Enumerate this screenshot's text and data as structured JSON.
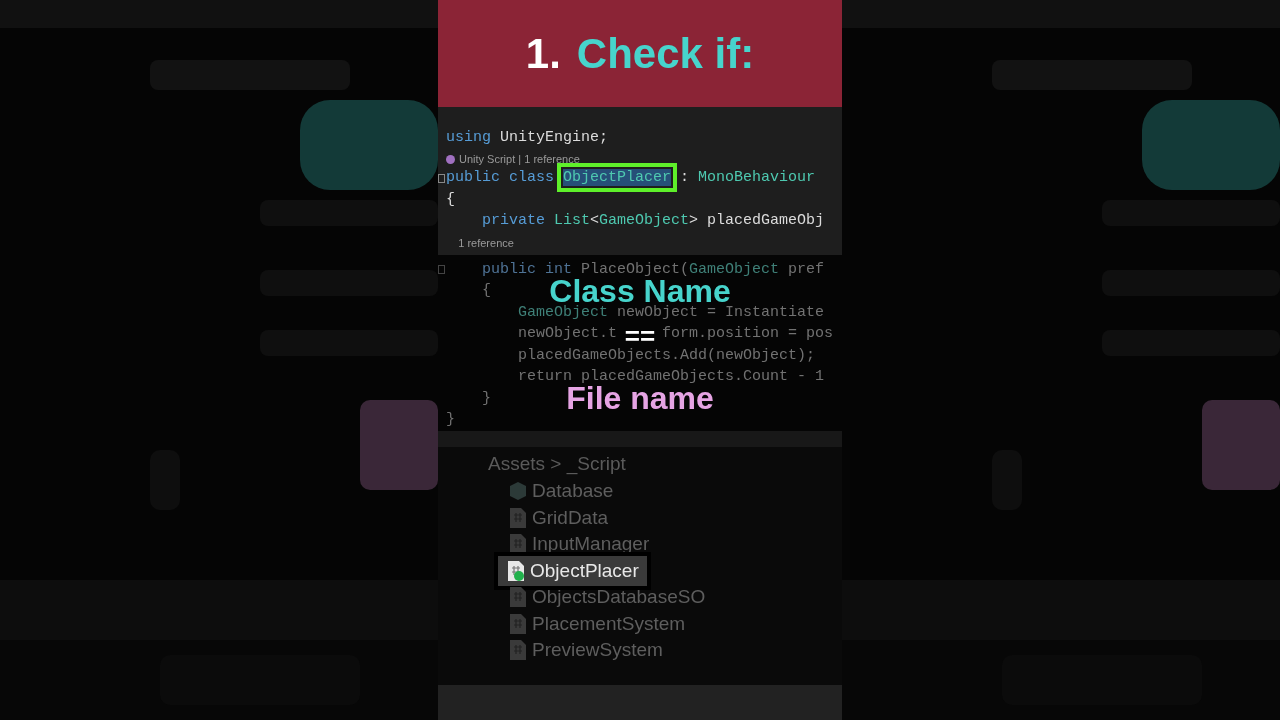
{
  "banner": {
    "number": "1.",
    "title": "Check if:"
  },
  "code_editor": {
    "lines": [
      {
        "kind": "code",
        "dimmed": false,
        "tokens": [
          {
            "text": "using",
            "kind": "keyword"
          },
          {
            "text": " UnityEngine;",
            "kind": "plain"
          }
        ]
      },
      {
        "kind": "hint",
        "dimmed": false,
        "text": "Unity Script | 1 reference",
        "icon": true
      },
      {
        "kind": "code",
        "dimmed": false,
        "fold": true,
        "tokens": [
          {
            "text": "public class ",
            "kind": "keyword"
          },
          {
            "text": "ObjectPlacer",
            "kind": "selected"
          },
          {
            "text": " : ",
            "kind": "plain"
          },
          {
            "text": "MonoBehaviour",
            "kind": "type"
          }
        ]
      },
      {
        "kind": "code",
        "dimmed": false,
        "tokens": [
          {
            "text": "{",
            "kind": "plain"
          }
        ]
      },
      {
        "kind": "code",
        "dimmed": false,
        "tokens": [
          {
            "text": "    private ",
            "kind": "keyword"
          },
          {
            "text": "List",
            "kind": "type"
          },
          {
            "text": "<",
            "kind": "plain"
          },
          {
            "text": "GameObject",
            "kind": "type"
          },
          {
            "text": "> placedGameObj",
            "kind": "plain"
          }
        ]
      },
      {
        "kind": "hint",
        "dimmed": false,
        "text": "    1 reference",
        "icon": false
      },
      {
        "kind": "code",
        "dimmed": true,
        "fold": true,
        "tokens": [
          {
            "text": "    public int ",
            "kind": "keyword"
          },
          {
            "text": "PlaceObject(",
            "kind": "plain"
          },
          {
            "text": "GameObject",
            "kind": "type"
          },
          {
            "text": " pref",
            "kind": "plain"
          }
        ]
      },
      {
        "kind": "code",
        "dimmed": true,
        "tokens": [
          {
            "text": "    {",
            "kind": "plain"
          }
        ]
      },
      {
        "kind": "code",
        "dimmed": true,
        "tokens": [
          {
            "text": "        GameObject",
            "kind": "type"
          },
          {
            "text": " newObject = Instantiate",
            "kind": "plain"
          }
        ]
      },
      {
        "kind": "code",
        "dimmed": true,
        "tokens": [
          {
            "text": "        newObject.t",
            "kind": "plain"
          },
          {
            "kind": "covered"
          },
          {
            "text": "form.position = pos",
            "kind": "plain"
          }
        ]
      },
      {
        "kind": "code",
        "dimmed": true,
        "tokens": [
          {
            "text": "        placedGameObjects.Add(newObject);",
            "kind": "plain"
          }
        ]
      },
      {
        "kind": "code",
        "dimmed": true,
        "tokens": [
          {
            "text": "        return placedGameObjects.Count - 1",
            "kind": "plain"
          }
        ]
      },
      {
        "kind": "code",
        "dimmed": true,
        "tokens": [
          {
            "text": "    }",
            "kind": "plain"
          }
        ]
      },
      {
        "kind": "code",
        "dimmed": true,
        "tokens": [
          {
            "text": "}",
            "kind": "plain"
          }
        ]
      }
    ]
  },
  "overlay": {
    "top": "Class Name",
    "middle": "==",
    "bottom": "File name"
  },
  "project_panel": {
    "breadcrumb": "Assets > _Script",
    "items": [
      {
        "name": "Database",
        "kind": "folder",
        "selected": false
      },
      {
        "name": "GridData",
        "kind": "script",
        "selected": false
      },
      {
        "name": "InputManager",
        "kind": "script",
        "selected": false
      },
      {
        "name": "ObjectPlacer",
        "kind": "script",
        "selected": true
      },
      {
        "name": "ObjectsDatabaseSO",
        "kind": "script",
        "selected": false
      },
      {
        "name": "PlacementSystem",
        "kind": "script",
        "selected": false
      },
      {
        "name": "PreviewSystem",
        "kind": "script",
        "selected": false
      }
    ]
  }
}
